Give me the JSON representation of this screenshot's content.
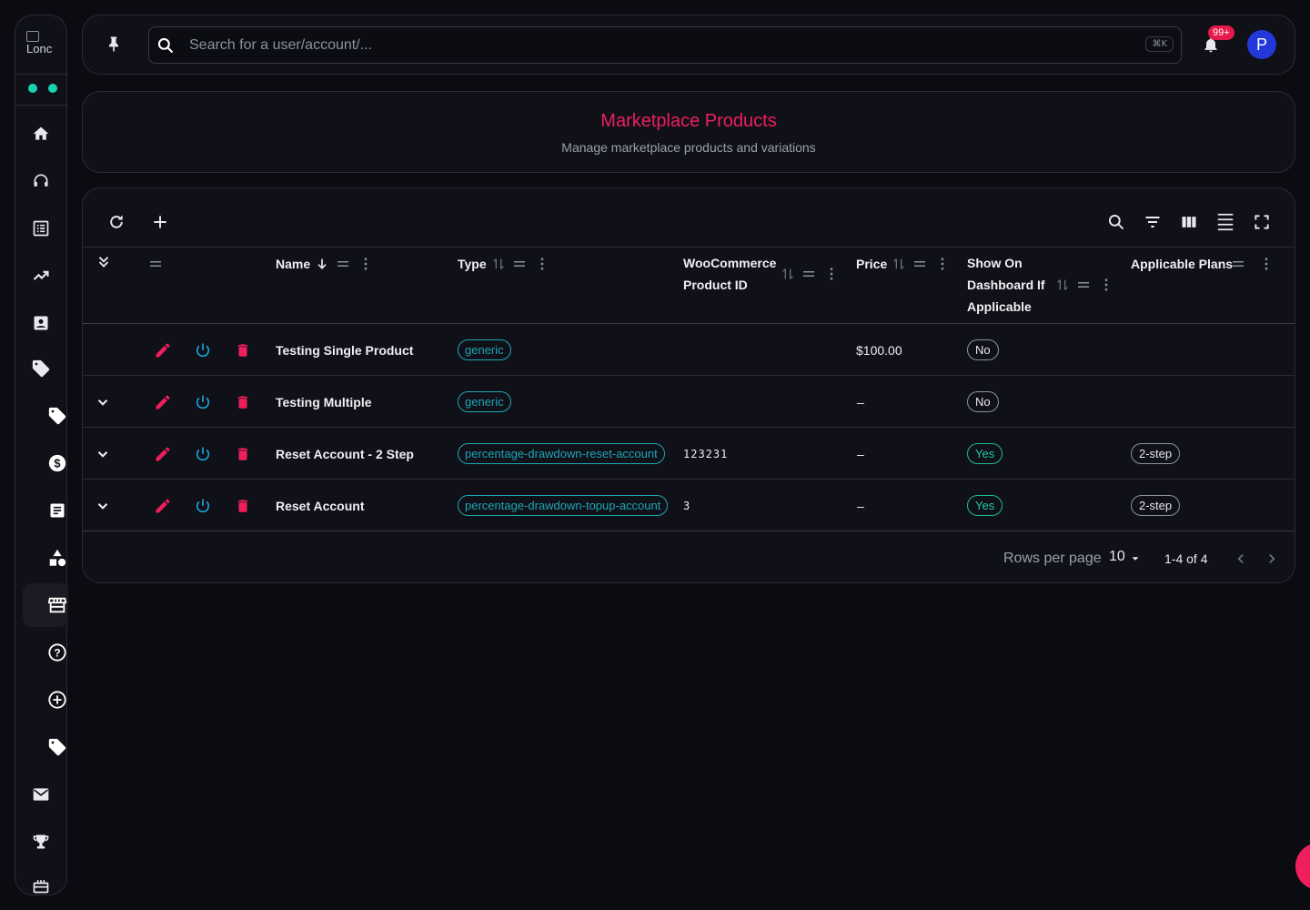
{
  "sidebar": {
    "logo_alt": "Lonc",
    "icons": [
      "home-icon",
      "support-agent-icon",
      "list-alt-icon",
      "trending-up-icon",
      "contact-icon",
      "tag-icon",
      "tag-sub-icon",
      "dollar-icon",
      "article-icon",
      "category-icon",
      "storefront-icon",
      "help-icon",
      "add-circle-icon",
      "tag-icon-2",
      "mail-icon",
      "trophy-icon",
      "cake-icon"
    ],
    "status_color": "#19d3b0"
  },
  "topbar": {
    "search_placeholder": "Search for a user/account/...",
    "shortcut": "⌘K",
    "notification_count": "99+",
    "avatar_initial": "P"
  },
  "header": {
    "title": "Marketplace Products",
    "subtitle": "Manage marketplace products and variations"
  },
  "table": {
    "columns": {
      "name": "Name",
      "type": "Type",
      "woo_line1": "WooCommerce",
      "woo_line2": "Product ID",
      "price": "Price",
      "show_line1": "Show On",
      "show_line2": "Dashboard If",
      "show_line3": "Applicable",
      "plans": "Applicable Plans"
    },
    "rows": [
      {
        "name": "Testing Single Product",
        "type": "generic",
        "woo_id": "",
        "price": "$100.00",
        "show": "No",
        "plan": ""
      },
      {
        "name": "Testing Multiple",
        "type": "generic",
        "woo_id": "",
        "price": "–",
        "show": "No",
        "plan": ""
      },
      {
        "name": "Reset Account - 2 Step",
        "type": "percentage-drawdown-reset-account",
        "woo_id": "123231",
        "price": "–",
        "show": "Yes",
        "plan": "2-step"
      },
      {
        "name": "Reset Account",
        "type": "percentage-drawdown-topup-account",
        "woo_id": "3",
        "price": "–",
        "show": "Yes",
        "plan": "2-step"
      }
    ],
    "footer": {
      "rows_per_page_label": "Rows per page",
      "rows_per_page_value": "10",
      "range": "1-4 of 4"
    }
  },
  "colors": {
    "accent": "#ef1f5e",
    "teal": "#1ea7b5",
    "power": "#1aa3d9",
    "bg": "#0b0b12"
  }
}
